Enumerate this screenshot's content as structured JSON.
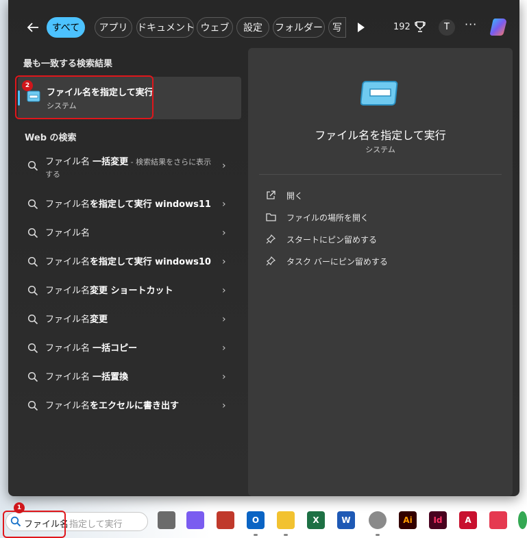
{
  "filters": {
    "chips": [
      "すべて",
      "アプリ",
      "ドキュメント",
      "ウェブ",
      "設定",
      "フォルダー",
      "写"
    ],
    "points": "192",
    "avatar": "T",
    "more": "···"
  },
  "best_match": {
    "section": "最も一致する検索結果",
    "name": "ファイル名を指定して実行",
    "type": "システム",
    "badge": "2"
  },
  "web": {
    "section": "Web の検索",
    "items": [
      {
        "before": "ファイル名 ",
        "bold": "一括変更",
        "after": " - 検索結果をさらに表示する"
      },
      {
        "before": "ファイル名",
        "bold": "を指定して実行 windows11",
        "after": ""
      },
      {
        "before": "ファイル名",
        "bold": "",
        "after": ""
      },
      {
        "before": "ファイル名",
        "bold": "を指定して実行 windows10",
        "after": ""
      },
      {
        "before": "ファイル名",
        "bold": "変更 ショートカット",
        "after": ""
      },
      {
        "before": "ファイル名",
        "bold": "変更",
        "after": ""
      },
      {
        "before": "ファイル名 ",
        "bold": "一括コピー",
        "after": ""
      },
      {
        "before": "ファイル名 ",
        "bold": "一括置換",
        "after": ""
      },
      {
        "before": "ファイル名",
        "bold": "をエクセルに書き出す",
        "after": ""
      }
    ]
  },
  "detail": {
    "name": "ファイル名を指定して実行",
    "type": "システム",
    "actions": [
      "開く",
      "ファイルの場所を開く",
      "スタートにピン留めする",
      "タスク バーにピン留めする"
    ]
  },
  "taskbar": {
    "search_value": "ファイル名",
    "search_placeholder": "指定して実行",
    "badge": "1",
    "apps": [
      {
        "name": "task-view",
        "label": "",
        "color": "#6b6b6b"
      },
      {
        "name": "copilot",
        "label": "",
        "color": "#7a5cf0"
      },
      {
        "name": "snipping-tool",
        "label": "",
        "color": "#c0392b"
      },
      {
        "name": "outlook",
        "label": "O",
        "color": "#0a64c4"
      },
      {
        "name": "file-explorer",
        "label": "",
        "color": "#f2c230"
      },
      {
        "name": "excel",
        "label": "X",
        "color": "#1d7044"
      },
      {
        "name": "word",
        "label": "W",
        "color": "#1e59b5"
      },
      {
        "name": "app-gray",
        "label": "",
        "color": "#8a8a8a"
      },
      {
        "name": "illustrator",
        "label": "Ai",
        "color": "#330000"
      },
      {
        "name": "indesign",
        "label": "Id",
        "color": "#49021f"
      },
      {
        "name": "autocad",
        "label": "A",
        "color": "#c8102e"
      },
      {
        "name": "red-cube-app",
        "label": "",
        "color": "#e53950"
      },
      {
        "name": "chrome",
        "label": "",
        "color": "#34a853"
      }
    ]
  }
}
